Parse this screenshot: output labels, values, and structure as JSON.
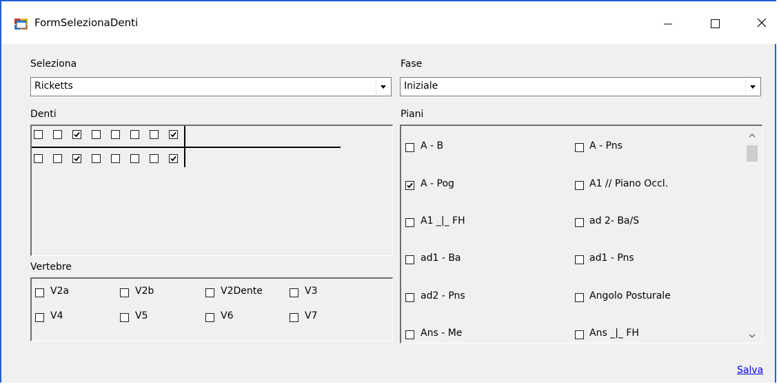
{
  "window": {
    "title": "FormSelezionaDenti"
  },
  "seleziona": {
    "label": "Seleziona",
    "value": "Ricketts"
  },
  "fase": {
    "label": "Fase",
    "value": "Iniziale"
  },
  "denti": {
    "label": "Denti",
    "upper_row_checked": [
      false,
      false,
      true,
      false,
      false,
      false,
      false,
      true
    ],
    "lower_row_checked": [
      false,
      false,
      true,
      false,
      false,
      false,
      false,
      true
    ]
  },
  "vertebre": {
    "label": "Vertebre",
    "items": [
      {
        "label": "V2a",
        "checked": false
      },
      {
        "label": "V2b",
        "checked": false
      },
      {
        "label": "V2Dente",
        "checked": false
      },
      {
        "label": "V3",
        "checked": false
      },
      {
        "label": "V4",
        "checked": false
      },
      {
        "label": "V5",
        "checked": false
      },
      {
        "label": "V6",
        "checked": false
      },
      {
        "label": "V7",
        "checked": false
      }
    ]
  },
  "piani": {
    "label": "Piani",
    "items": [
      {
        "label": "A - B",
        "checked": false
      },
      {
        "label": "A - Pns",
        "checked": false
      },
      {
        "label": "A - Pog",
        "checked": true
      },
      {
        "label": "A1 // Piano Occl.",
        "checked": false
      },
      {
        "label": "A1 _|_ FH",
        "checked": false
      },
      {
        "label": "ad 2- Ba/S",
        "checked": false
      },
      {
        "label": "ad1 - Ba",
        "checked": false
      },
      {
        "label": "ad1 - Pns",
        "checked": false
      },
      {
        "label": "ad2 - Pns",
        "checked": false
      },
      {
        "label": "Angolo Posturale",
        "checked": false
      },
      {
        "label": "Ans - Me",
        "checked": false
      },
      {
        "label": "Ans _|_ FH",
        "checked": false
      }
    ]
  },
  "salva": {
    "label": "Salva"
  }
}
